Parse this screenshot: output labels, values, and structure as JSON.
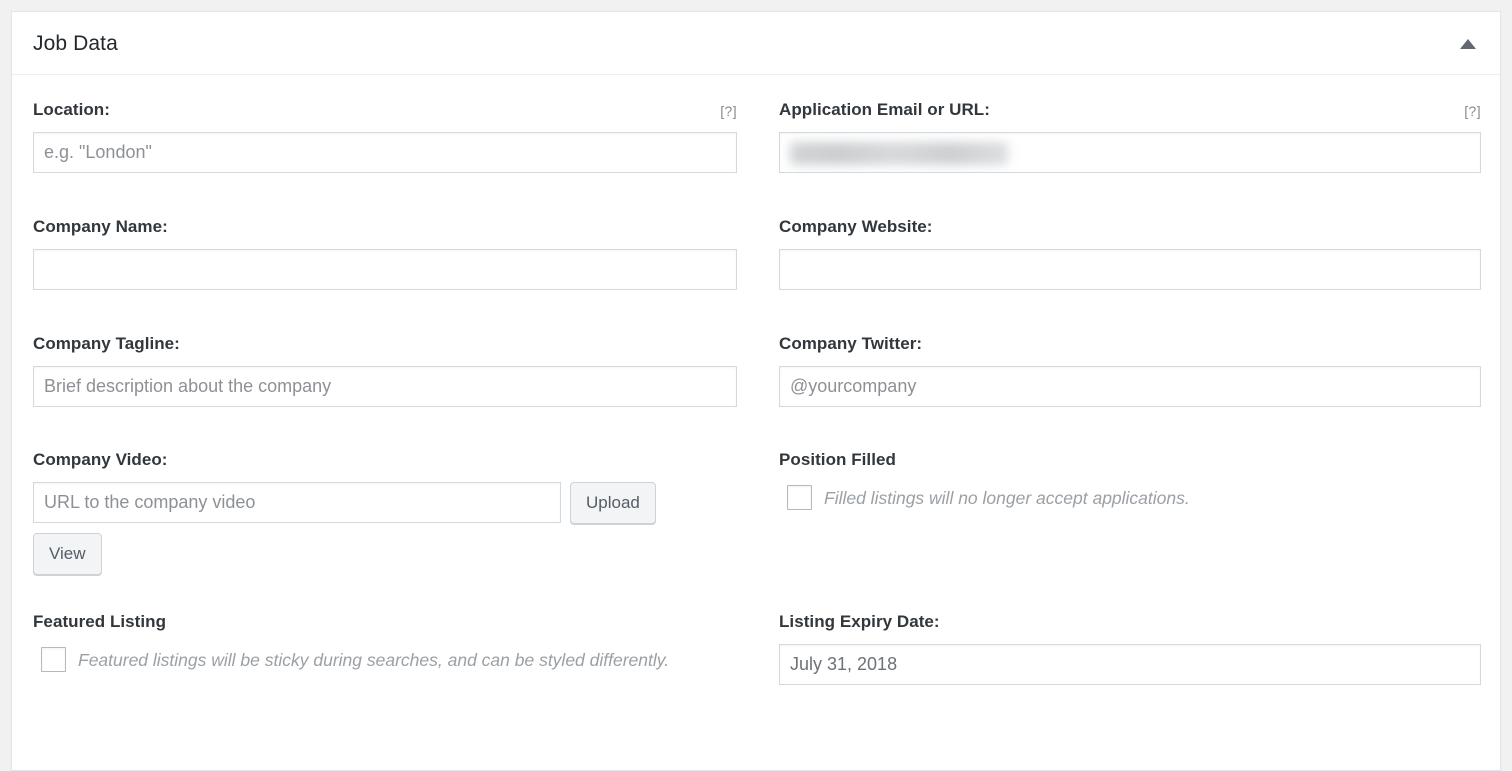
{
  "panel": {
    "title": "Job Data",
    "toggle_icon": "triangle-up-icon",
    "toggle_state": "expanded"
  },
  "colors": {
    "page_background": "#f1f1f1",
    "panel_background": "#ffffff",
    "panel_border": "#e2e4e7",
    "label_text": "#32373c",
    "placeholder_text": "#8d9196",
    "description_text": "#9ba0a5",
    "help_tip_text": "#8a8a8a",
    "input_border": "#d5d8dc",
    "button_background": "#f3f4f5",
    "button_border": "#cfd3d7",
    "toggle_arrow": "#646970"
  },
  "fields": {
    "location": {
      "label": "Location:",
      "help": "[?]",
      "placeholder": "e.g. \"London\"",
      "value": ""
    },
    "application": {
      "label": "Application Email or URL:",
      "help": "[?]",
      "placeholder": "",
      "value": "",
      "redacted": true
    },
    "company_name": {
      "label": "Company Name:",
      "placeholder": "",
      "value": ""
    },
    "company_website": {
      "label": "Company Website:",
      "placeholder": "",
      "value": ""
    },
    "company_tagline": {
      "label": "Company Tagline:",
      "placeholder": "Brief description about the company",
      "value": ""
    },
    "company_twitter": {
      "label": "Company Twitter:",
      "placeholder": "@yourcompany",
      "value": ""
    },
    "company_video": {
      "label": "Company Video:",
      "placeholder": "URL to the company video",
      "value": "",
      "upload_label": "Upload",
      "view_label": "View"
    },
    "position_filled": {
      "label": "Position Filled",
      "description": "Filled listings will no longer accept applications.",
      "checked": false
    },
    "featured_listing": {
      "label": "Featured Listing",
      "description": "Featured listings will be sticky during searches, and can be styled differently.",
      "checked": false
    },
    "listing_expiry": {
      "label": "Listing Expiry Date:",
      "placeholder": "",
      "value": "July 31, 2018"
    }
  }
}
